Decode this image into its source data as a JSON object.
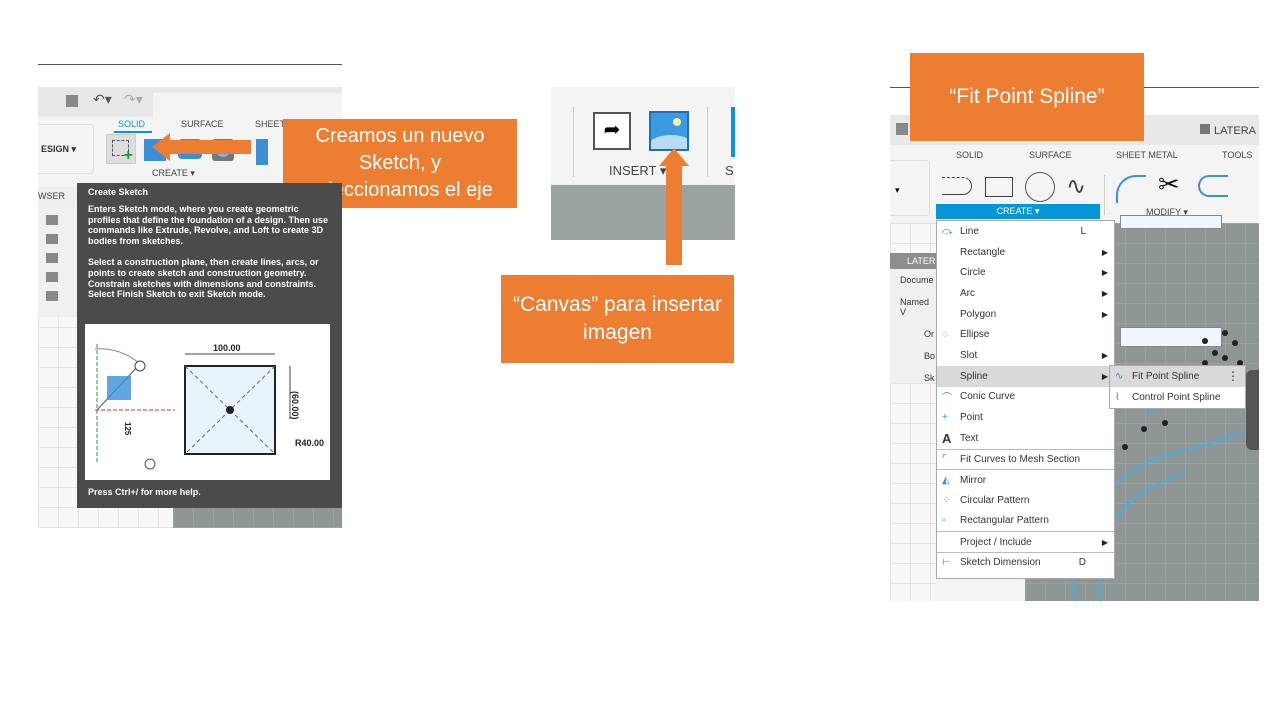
{
  "callouts": {
    "sketch": "Creamos un nuevo Sketch, y seleccionamos el eje",
    "canvas": "“Canvas” para insertar imagen",
    "spline": "“Fit Point Spline”"
  },
  "left": {
    "tabs": [
      "SOLID",
      "SURFACE",
      "SHEET"
    ],
    "design_label": "ESIGN ▾",
    "create_label": "CREATE ▾",
    "browser_label": "WSER",
    "tooltip": {
      "title": "Create Sketch",
      "p1": "Enters Sketch mode, where you create geometric profiles that define the foundation of a design. Then use commands like Extrude, Revolve, and Loft to create 3D bodies from sketches.",
      "p2": "Select a construction plane, then create lines, arcs, or points to create sketch and construction geometry. Constrain sketches with dimensions and constraints. Select Finish Sketch to exit Sketch mode.",
      "footer": "Press Ctrl+/ for more help.",
      "dims": {
        "width": "100.00",
        "height": "(60.00)",
        "radius": "R40.00",
        "small": "125"
      }
    }
  },
  "middle": {
    "insert_label": "INSERT ▾",
    "cut_label": "S"
  },
  "right": {
    "doc_title": "LATERA",
    "tabs": [
      "SOLID",
      "SURFACE",
      "SHEET METAL",
      "TOOLS"
    ],
    "create_label": "CREATE ▾",
    "modify_label": "MODIFY ▾",
    "browser": [
      "LATER",
      "Docume",
      "Named V",
      "Or",
      "Bo",
      "Sk"
    ],
    "menu": [
      {
        "label": "Line",
        "shortcut": "L",
        "icon": "line-icon"
      },
      {
        "label": "Rectangle",
        "submenu": true
      },
      {
        "label": "Circle",
        "submenu": true
      },
      {
        "label": "Arc",
        "submenu": true
      },
      {
        "label": "Polygon",
        "submenu": true
      },
      {
        "label": "Ellipse",
        "icon": "ellipse-icon"
      },
      {
        "label": "Slot",
        "submenu": true
      },
      {
        "label": "Spline",
        "submenu": true,
        "highlighted": true
      },
      {
        "label": "Conic Curve",
        "icon": "conic-curve-icon"
      },
      {
        "label": "Point",
        "icon": "point-icon"
      },
      {
        "label": "Text",
        "icon": "text-icon"
      },
      {
        "label": "Fit Curves to Mesh Section",
        "icon": "fit-curves-icon",
        "separator": true
      },
      {
        "label": "Mirror",
        "icon": "mirror-icon",
        "separator": true
      },
      {
        "label": "Circular Pattern",
        "icon": "circular-pattern-icon"
      },
      {
        "label": "Rectangular Pattern",
        "icon": "rectangular-pattern-icon"
      },
      {
        "label": "Project / Include",
        "submenu": true,
        "separator": true
      },
      {
        "label": "Sketch Dimension",
        "shortcut": "D",
        "icon": "sketch-dimension-icon",
        "separator": true
      }
    ],
    "submenu": [
      {
        "label": "Fit Point Spline",
        "highlighted": true
      },
      {
        "label": "Control Point Spline"
      }
    ]
  },
  "colors": {
    "accent": "#ed7d31",
    "fusion_blue": "#0696d7",
    "tooltip_bg": "#4b4b4b"
  }
}
